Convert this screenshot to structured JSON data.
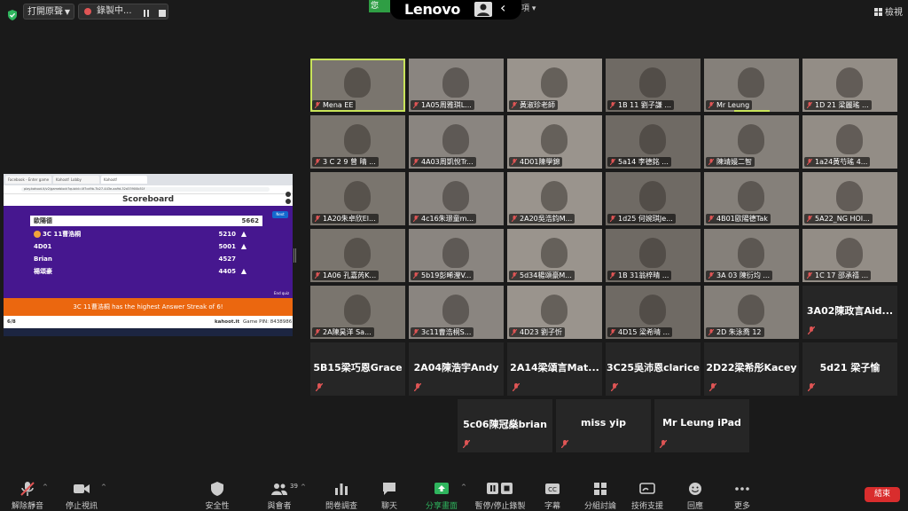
{
  "topbar": {
    "dropdown_label": "打開原聲",
    "recording_label": "錄製中...",
    "green_chip": "您",
    "lenovo_logo": "Lenovo",
    "view_label": "檢視",
    "partial_label": "項"
  },
  "shared_screen": {
    "browser_tabs": [
      "Facebook - Enter game PIN",
      "Kahoot! Lobby",
      "Kahoot!"
    ],
    "url": "play.kahoot.it/v2/gameblock?quizId=4f7cd9b-7b27-443e-aa9d-32d33900b51f",
    "title": "Scoreboard",
    "next_label": "Next",
    "end_label": "End quiz",
    "rows": [
      {
        "name": "歐陽德",
        "score": "5662"
      },
      {
        "name": "3C 11曹浩桐",
        "score": "5210"
      },
      {
        "name": "4D01",
        "score": "5001"
      },
      {
        "name": "Brian",
        "score": "4527"
      },
      {
        "name": "楊頌豪",
        "score": "4405"
      }
    ],
    "streak": "3C 11曹浩桐 has the highest Answer Streak of 6!",
    "page": "6/8",
    "footer_url": "kahoot.it",
    "pin": "Game PIN: 8438986"
  },
  "gallery": {
    "video_tiles": [
      "Mena EE",
      "1A05周雅琪L...",
      "黃淑珍老師",
      "1B 11 劉子謙 ...",
      "Mr Leung",
      "1D 21 梁麗瑤 ...",
      "3 C 2 9 曾 晴 ...",
      "4A03周凱悅Tr...",
      "4D01陳學錦",
      "5a14 李德銘 ...",
      "陳靖嫚二智",
      "1a24黃芍瑤 4...",
      "1A20朱卓欣El...",
      "4c16朱璟童m...",
      "2A20吳浩鈞M...",
      "1d25 何婉琪Je...",
      "4B01歐陽德Tak",
      "5A22_NG HOI...",
      "1A06 孔嘉芮K...",
      "5b19彭晞瀅V...",
      "5d34楊頌豪M...",
      "1B 31翁梓晴 ...",
      "3A 03 陳衍均 ...",
      "1C 17 邵承禧 ...",
      "2A陳昊洋 Sa...",
      "3c11曹浩桐S...",
      "4D23 劉子忻",
      "4D15 梁希晴 ...",
      "2D 朱泳喬 12"
    ],
    "name_tiles": [
      "3A02陳政言Aid...",
      "5B15梁巧恩Grace",
      "2A04陳浩宇Andy",
      "2A14梁頌言Mat...",
      "3C25吳沛恩clarice",
      "2D22梁希彤Kacey",
      "5d21 梁子愉",
      "5c06陳冠燊brian",
      "miss yip",
      "Mr Leung iPad"
    ]
  },
  "toolbar": {
    "unmute": "解除靜音",
    "stop_video": "停止視訊",
    "security": "安全性",
    "participants": "與會者",
    "participants_count": "39",
    "polls": "問卷調查",
    "chat": "聊天",
    "share": "分享畫面",
    "pause_share": "暫停/停止錄製",
    "captions": "字幕",
    "breakout": "分組討論",
    "support": "技術支援",
    "reactions": "回應",
    "more": "更多",
    "end": "結束"
  },
  "colors": {
    "active_speaker": "#c8e35a",
    "kahoot_purple": "#46178f",
    "streak_orange": "#eb670f",
    "end_red": "#d92d2d",
    "share_green": "#2fb55e"
  }
}
